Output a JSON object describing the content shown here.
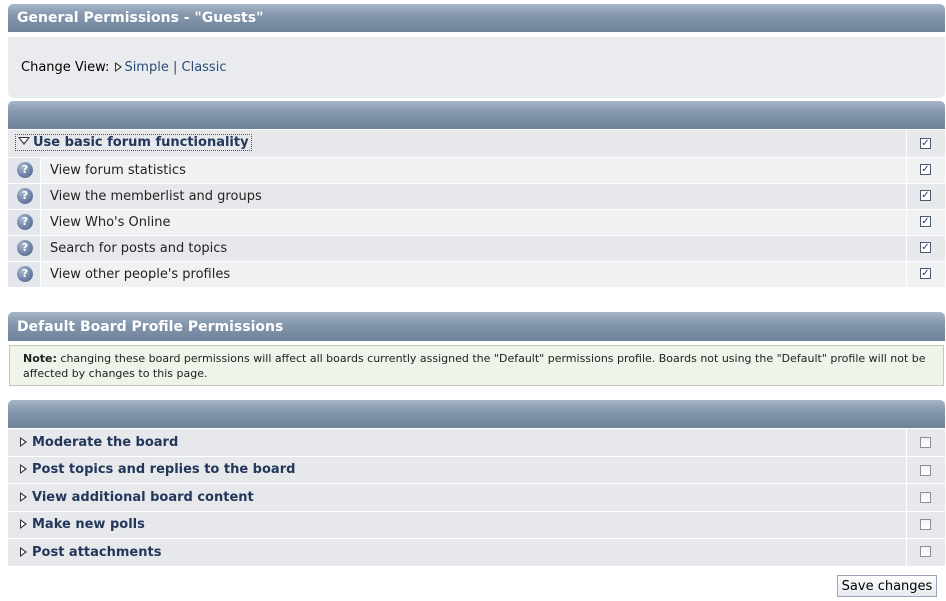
{
  "general": {
    "title": "General Permissions - \"Guests\"",
    "change_view_label": "Change View:",
    "view_simple": "Simple",
    "view_separator": "|",
    "view_classic": "Classic"
  },
  "basic_group": {
    "label": "Use basic forum functionality",
    "checked": true,
    "items": [
      {
        "label": "View forum statistics",
        "checked": true,
        "icon": "help-icon"
      },
      {
        "label": "View the memberlist and groups",
        "checked": true,
        "icon": "help-icon"
      },
      {
        "label": "View Who's Online",
        "checked": true,
        "icon": "help-icon"
      },
      {
        "label": "Search for posts and topics",
        "checked": true,
        "icon": "help-icon"
      },
      {
        "label": "View other people's profiles",
        "checked": true,
        "icon": "help-icon"
      }
    ]
  },
  "board": {
    "title": "Default Board Profile Permissions",
    "note_label": "Note:",
    "note_text": "changing these board permissions will affect all boards currently assigned the \"Default\" permissions profile. Boards not using the \"Default\" profile will not be affected by changes to this page.",
    "groups": [
      {
        "label": "Moderate the board",
        "checked": false
      },
      {
        "label": "Post topics and replies to the board",
        "checked": false
      },
      {
        "label": "View additional board content",
        "checked": false
      },
      {
        "label": "Make new polls",
        "checked": false
      },
      {
        "label": "Post attachments",
        "checked": false
      }
    ]
  },
  "save_label": "Save changes",
  "icon_glyph": "?",
  "check_glyph": "✓",
  "colors": {
    "header": "#8597ad",
    "link": "#2c4d7a",
    "note_bg": "#eef4ea"
  }
}
